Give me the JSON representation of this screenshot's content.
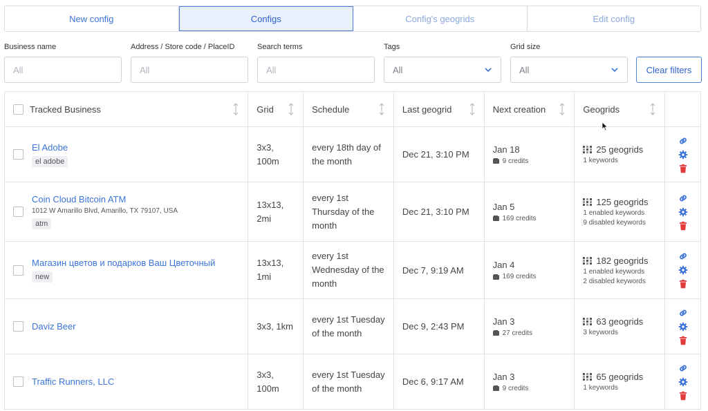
{
  "tabs": [
    {
      "label": "New config"
    },
    {
      "label": "Configs"
    },
    {
      "label": "Config's geogrids"
    },
    {
      "label": "Edit config"
    }
  ],
  "filters": {
    "business_name": {
      "label": "Business name",
      "placeholder": "All"
    },
    "address": {
      "label": "Address / Store code / PlaceID",
      "placeholder": "All"
    },
    "search_terms": {
      "label": "Search terms",
      "placeholder": "All"
    },
    "tags": {
      "label": "Tags",
      "value": "All"
    },
    "grid_size": {
      "label": "Grid size",
      "value": "All"
    },
    "clear_label": "Clear filters"
  },
  "table": {
    "headers": [
      "Tracked Business",
      "Grid",
      "Schedule",
      "Last geogrid",
      "Next creation",
      "Geogrids"
    ],
    "rows": [
      {
        "name": "El Adobe",
        "address": "",
        "tag": "el adobe",
        "grid": "3x3, 100m",
        "schedule": "every 18th day of the month",
        "last": "Dec 21, 3:10 PM",
        "next": "Jan 18",
        "credits": "9 credits",
        "geogrids": "25 geogrids",
        "kw1": "1 keywords",
        "kw2": ""
      },
      {
        "name": "Coin Cloud Bitcoin ATM",
        "address": "1012 W Amarillo Blvd, Amarillo, TX 79107, USA",
        "tag": "atm",
        "grid": "13x13, 2mi",
        "schedule": "every 1st Thursday of the month",
        "last": "Dec 21, 3:10 PM",
        "next": "Jan 5",
        "credits": "169 credits",
        "geogrids": "125 geogrids",
        "kw1": "1 enabled keywords",
        "kw2": "9 disabled keywords"
      },
      {
        "name": "Магазин цветов и подарков Ваш Цветочный",
        "address": "",
        "tag": "new",
        "grid": "13x13, 1mi",
        "schedule": "every 1st Wednesday of the month",
        "last": "Dec 7, 9:19 AM",
        "next": "Jan 4",
        "credits": "169 credits",
        "geogrids": "182 geogrids",
        "kw1": "1 enabled keywords",
        "kw2": "2 disabled keywords"
      },
      {
        "name": "Daviz Beer",
        "address": "",
        "tag": "",
        "grid": "3x3, 1km",
        "schedule": "every 1st Tuesday of the month",
        "last": "Dec 9, 2:43 PM",
        "next": "Jan 3",
        "credits": "27 credits",
        "geogrids": "63 geogrids",
        "kw1": "3 keywords",
        "kw2": ""
      },
      {
        "name": "Traffic Runners, LLC",
        "address": "",
        "tag": "",
        "grid": "3x3, 100m",
        "schedule": "every 1st Tuesday of the month",
        "last": "Dec 6, 9:17 AM",
        "next": "Jan 3",
        "credits": "9 credits",
        "geogrids": "65 geogrids",
        "kw1": "1 keywords",
        "kw2": ""
      }
    ]
  },
  "colors": {
    "link": "#3b73d8",
    "accent": "#4d7fd7",
    "delete": "#e23b3b"
  },
  "icons": [
    "link-icon",
    "gear-icon",
    "trash-icon",
    "grid-icon",
    "wallet-icon",
    "sort-icon",
    "chevron-down-icon"
  ]
}
